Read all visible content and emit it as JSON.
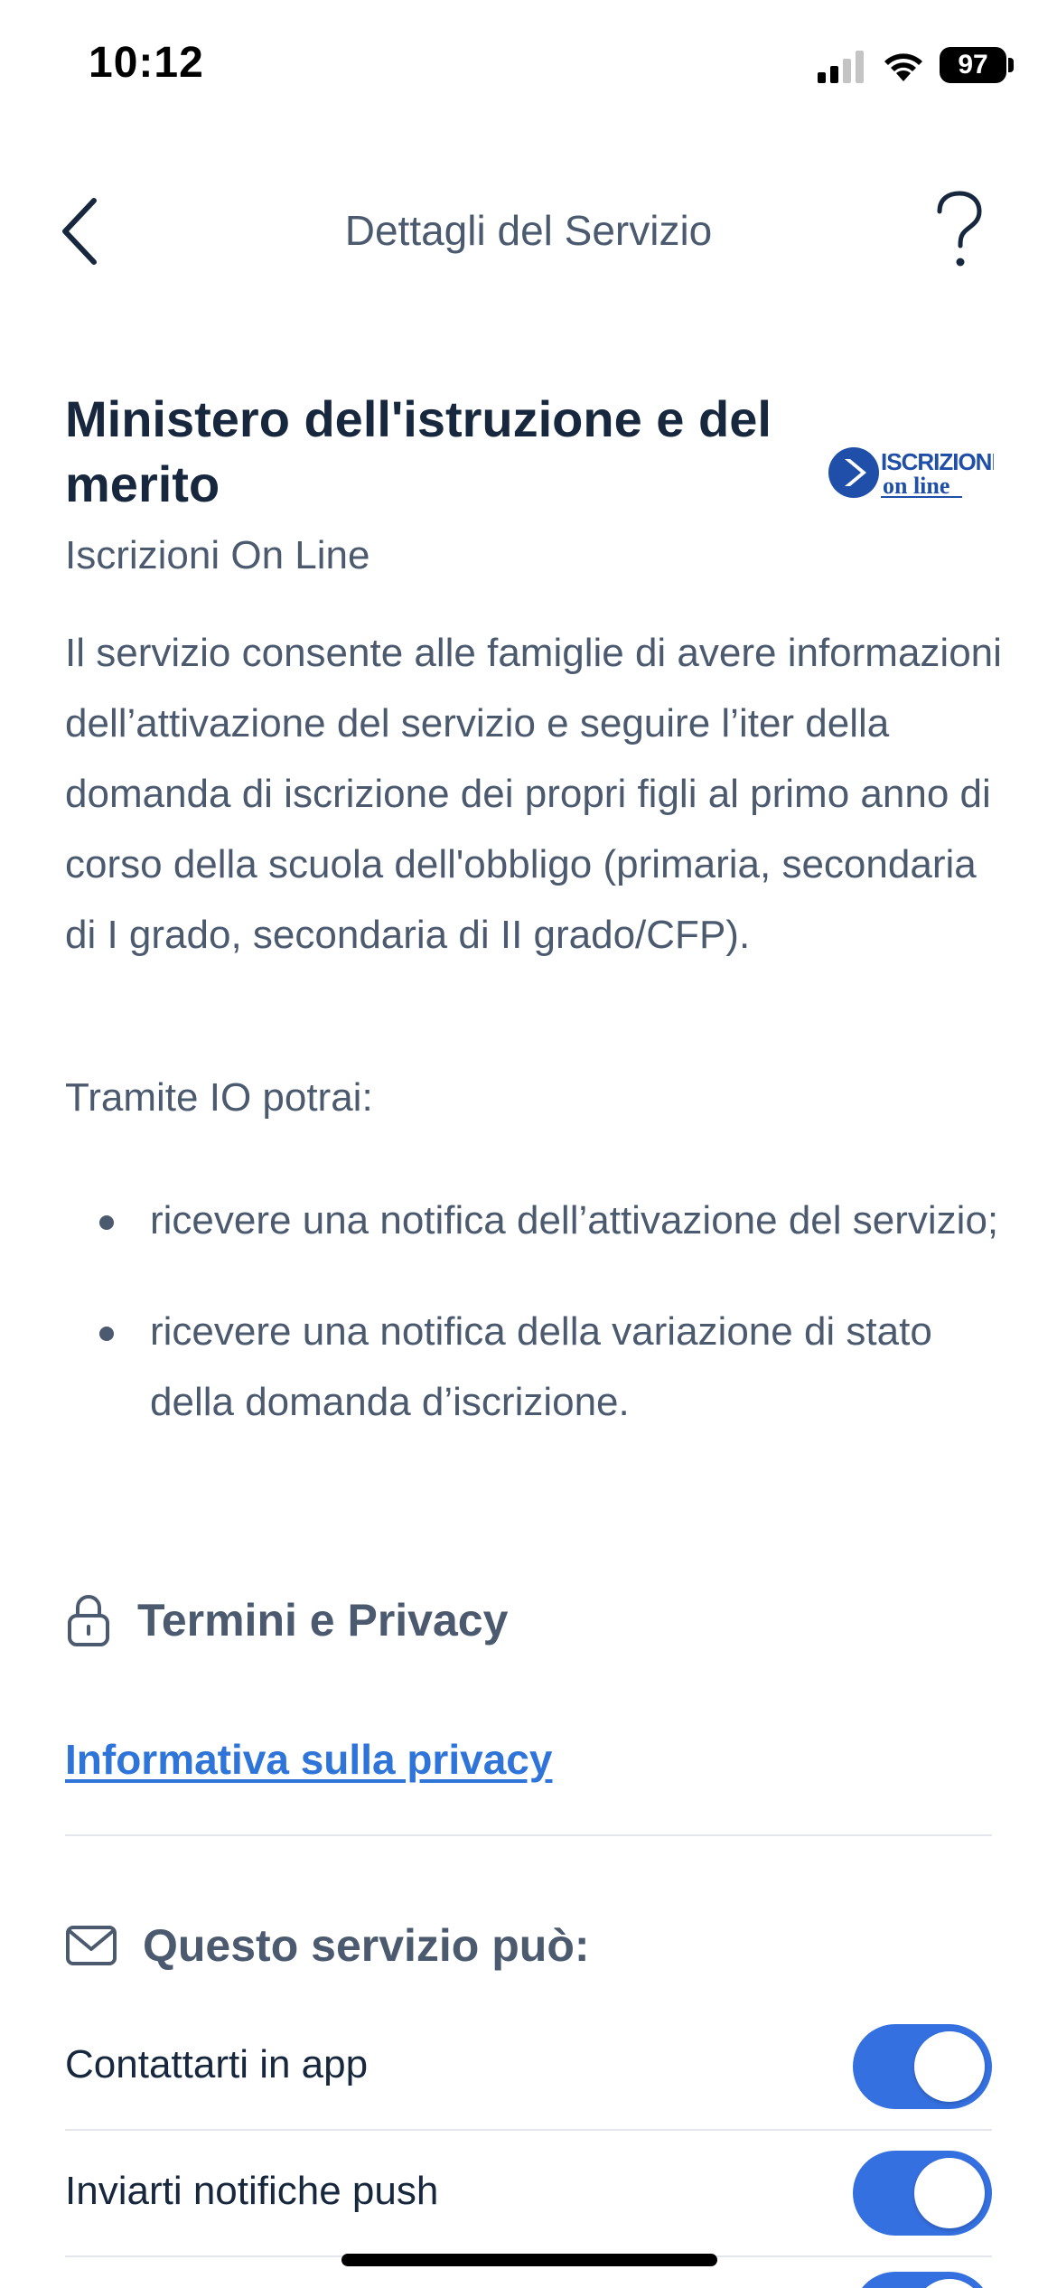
{
  "status_bar": {
    "time": "10:12",
    "battery": "97"
  },
  "header": {
    "title": "Dettagli del Servizio",
    "back_icon": "chevron-left-icon",
    "help_icon": "question-mark-icon"
  },
  "service": {
    "organization": "Ministero dell'istruzione e del merito",
    "name": "Iscrizioni On Line",
    "logo": {
      "line1": "ISCRIZIONI",
      "line2": "on line"
    },
    "description": "Il servizio consente alle famiglie di avere informazioni dell’attivazione del servizio e seguire l’iter della domanda di iscrizione dei propri figli al primo anno di corso della scuola dell'obbligo (primaria, secondaria di I grado, secondaria di II grado/CFP).",
    "intro": "Tramite IO potrai:",
    "bullets": [
      "ricevere una notifica dell’attivazione del servizio;",
      "ricevere una notifica della variazione di stato della domanda d’iscrizione."
    ]
  },
  "privacy": {
    "section_title": "Termini e Privacy",
    "section_icon": "lock-icon",
    "link_label": "Informativa sulla privacy"
  },
  "permissions": {
    "section_title": "Questo servizio può:",
    "section_icon": "envelope-icon",
    "items": [
      {
        "label": "Contattarti in app",
        "enabled": true
      },
      {
        "label": "Inviarti notifiche push",
        "enabled": true
      }
    ]
  },
  "colors": {
    "accent": "#3570E0",
    "link": "#2F74D8",
    "heading": "#17273D",
    "body_text": "#4B5A6E"
  }
}
